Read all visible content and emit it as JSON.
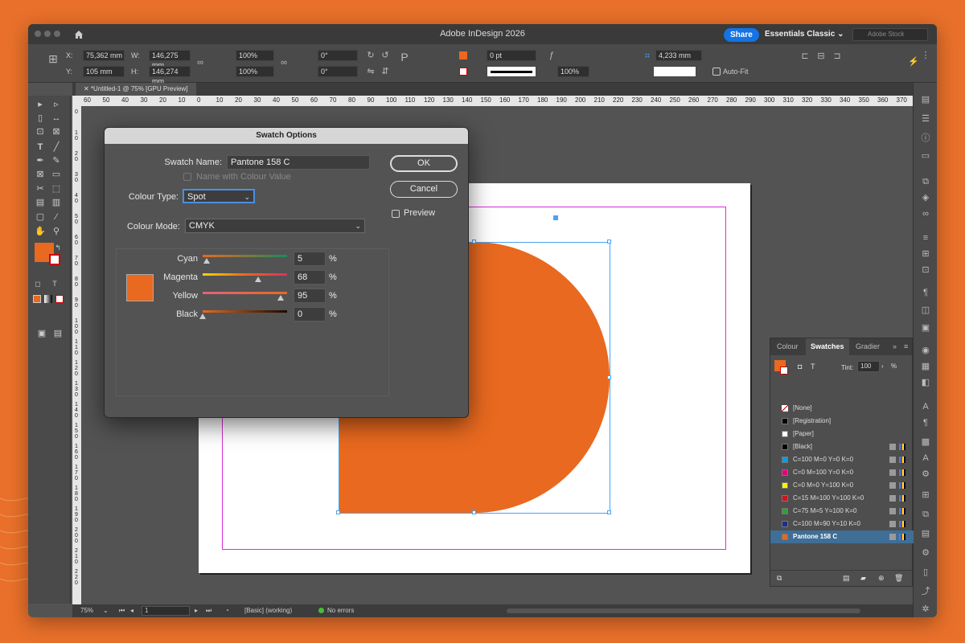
{
  "app": {
    "title": "Adobe InDesign 2026",
    "share_label": "Share",
    "workspace_label": "Essentials Classic",
    "stock_placeholder": "Adobe Stock"
  },
  "control_bar": {
    "x_label": "X:",
    "x_value": "75,362 mm",
    "y_label": "Y:",
    "y_value": "105 mm",
    "w_label": "W:",
    "w_value": "146,275 mm",
    "h_label": "H:",
    "h_value": "146,274 mm",
    "scale_x": "100%",
    "scale_y": "100%",
    "rotate": "0°",
    "shear": "0°",
    "stroke_weight": "0 pt",
    "opacity": "100%",
    "gap": "4,233 mm",
    "auto_fit_label": "Auto-Fit"
  },
  "document_tab": {
    "label": "*Untitled-1 @ 75% [GPU Preview]"
  },
  "ruler_h": [
    "60",
    "50",
    "40",
    "30",
    "20",
    "10",
    "0",
    "10",
    "20",
    "30",
    "40",
    "50",
    "60",
    "70",
    "80",
    "90",
    "100",
    "110",
    "120",
    "130",
    "140",
    "150",
    "160",
    "170",
    "180",
    "190",
    "200",
    "210",
    "220",
    "230",
    "240",
    "250",
    "260",
    "270",
    "280",
    "290",
    "300",
    "310",
    "320",
    "330",
    "340",
    "350",
    "360",
    "370"
  ],
  "ruler_v": [
    "0",
    "1 0",
    "2 0",
    "3 0",
    "4 0",
    "5 0",
    "6 0",
    "7 0",
    "8 0",
    "9 0",
    "1 0 0",
    "1 1 0",
    "1 2 0",
    "1 3 0",
    "1 4 0",
    "1 5 0",
    "1 6 0",
    "1 7 0",
    "1 8 0",
    "1 9 0",
    "2 0 0",
    "2 1 0",
    "2 2 0"
  ],
  "status_bar": {
    "zoom": "75%",
    "page": "1",
    "preflight_profile": "[Basic] (working)",
    "errors": "No errors"
  },
  "colors": {
    "accent_orange": "#e8691f",
    "selection_blue": "#4aa3f0",
    "margin_magenta": "#d62ed6",
    "share_blue": "#1473e6"
  },
  "swatches_panel": {
    "tabs": [
      "Colour",
      "Swatches",
      "Gradier"
    ],
    "tint_label": "Tint:",
    "tint_value": "100",
    "items": [
      {
        "name": "[None]",
        "color": "none"
      },
      {
        "name": "[Registration]",
        "color": "#000000"
      },
      {
        "name": "[Paper]",
        "color": "#ffffff"
      },
      {
        "name": "[Black]",
        "color": "#000000"
      },
      {
        "name": "C=100 M=0 Y=0 K=0",
        "color": "#00a0e9"
      },
      {
        "name": "C=0 M=100 Y=0 K=0",
        "color": "#e4007f"
      },
      {
        "name": "C=0 M=0 Y=100 K=0",
        "color": "#fff100"
      },
      {
        "name": "C=15 M=100 Y=100 K=0",
        "color": "#c9161c"
      },
      {
        "name": "C=75 M=5 Y=100 K=0",
        "color": "#2ea03a"
      },
      {
        "name": "C=100 M=90 Y=10 K=0",
        "color": "#1d2f88"
      },
      {
        "name": "Pantone 158 C",
        "color": "#e8691f"
      }
    ]
  },
  "dialog": {
    "title": "Swatch Options",
    "swatch_name_label": "Swatch Name:",
    "swatch_name_value": "Pantone 158 C",
    "name_with_value_label": "Name with Colour Value",
    "colour_type_label": "Colour Type:",
    "colour_type_value": "Spot",
    "colour_mode_label": "Colour Mode:",
    "colour_mode_value": "CMYK",
    "ok_label": "OK",
    "cancel_label": "Cancel",
    "preview_label": "Preview",
    "percent_sign": "%",
    "channels": [
      {
        "label": "Cyan",
        "value": "5"
      },
      {
        "label": "Magenta",
        "value": "68"
      },
      {
        "label": "Yellow",
        "value": "95"
      },
      {
        "label": "Black",
        "value": "0"
      }
    ]
  }
}
